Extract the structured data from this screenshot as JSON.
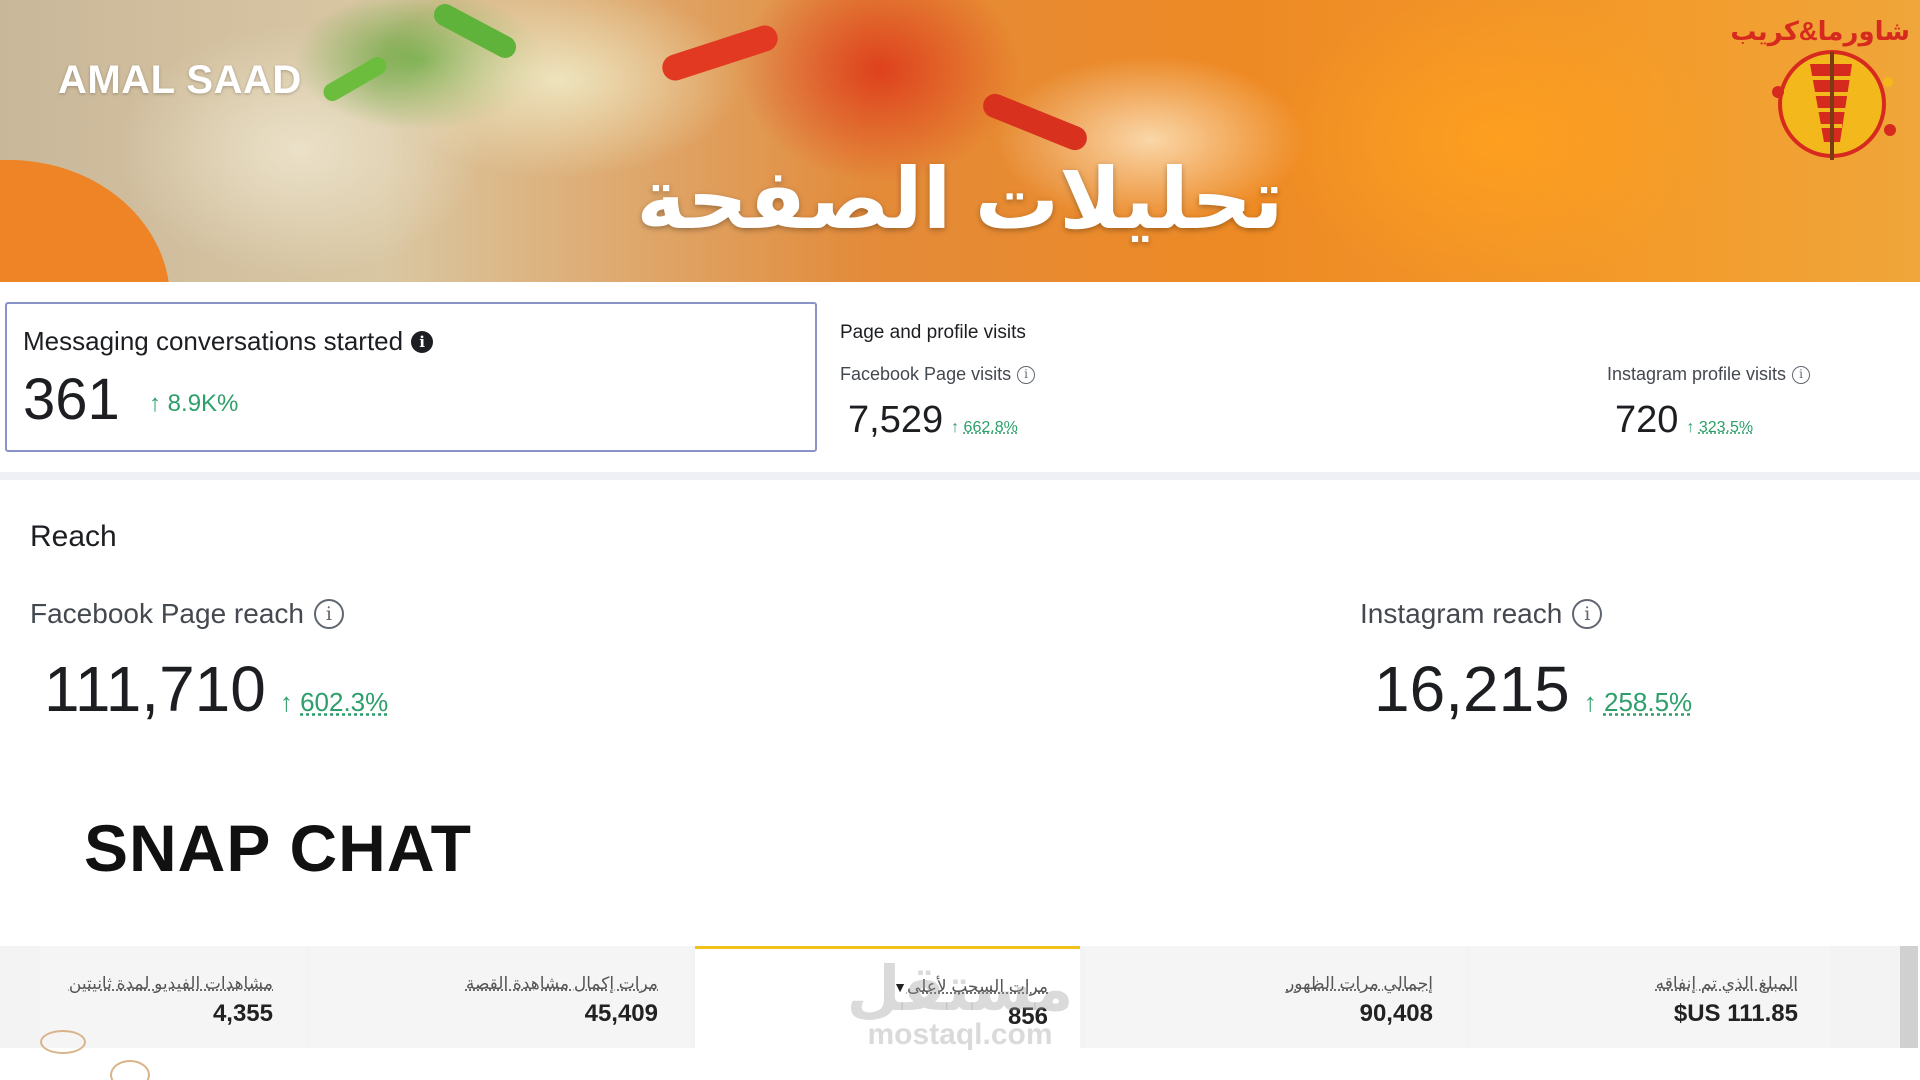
{
  "banner": {
    "brand_name": "AMAL SAAD",
    "page_title": "تحليلات الصفحة",
    "logo_text": "شاورما&كريب"
  },
  "messaging": {
    "label": "Messaging conversations started",
    "value": "361",
    "trend": "8.9K%"
  },
  "visits": {
    "title": "Page and profile visits",
    "items": [
      {
        "label": "Facebook Page visits",
        "value": "7,529",
        "trend": "662.8%"
      },
      {
        "label": "Instagram profile visits",
        "value": "720",
        "trend": "323.5%"
      }
    ]
  },
  "reach": {
    "title": "Reach",
    "items": [
      {
        "label": "Facebook Page reach",
        "value": "111,710",
        "trend": "602.3%"
      },
      {
        "label": "Instagram reach",
        "value": "16,215",
        "trend": "258.5%"
      }
    ]
  },
  "snap": {
    "title": "SNAP CHAT",
    "stats": [
      {
        "label": "المبلغ الذي تم إنفاقه",
        "value": "$US 111.85"
      },
      {
        "label": "إجمالي مرات الظهور",
        "value": "90,408"
      },
      {
        "label": "مرات السحب لأعلى",
        "value": "856"
      },
      {
        "label": "مرات إكمال مشاهدة القصة",
        "value": "45,409"
      },
      {
        "label": "مشاهدات الفيديو لمدة ثانيتين",
        "value": "4,355"
      }
    ]
  },
  "watermark": {
    "arabic": "مستقل",
    "latin": "mostaql.com"
  },
  "colors": {
    "trend_green": "#2e9e6a",
    "accent_orange": "#ef8426",
    "active_tab_yellow": "#f2c21b"
  }
}
